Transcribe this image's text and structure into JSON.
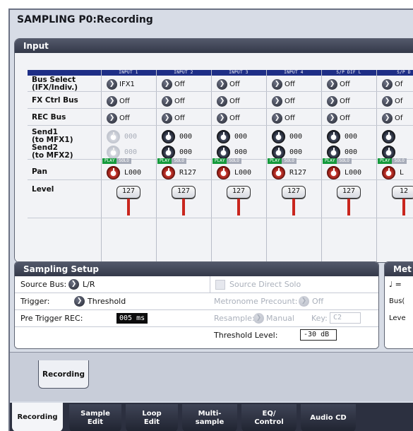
{
  "title": "SAMPLING P0:Recording",
  "input_panel": {
    "heading": "Input",
    "columns": [
      "INPUT 1",
      "INPUT 2",
      "INPUT 3",
      "INPUT 4",
      "S/P DIF L",
      "S/P D"
    ],
    "row_labels": {
      "bus_select": "Bus Select\n(IFX/Indiv.)",
      "fx_ctrl_bus": "FX Ctrl Bus",
      "rec_bus": "REC Bus",
      "send1": "Send1\n(to MFX1)",
      "send2": "Send2\n(to MFX2)",
      "pan": "Pan",
      "level": "Level"
    },
    "bus_select": [
      "IFX1",
      "Off",
      "Off",
      "Off",
      "Off",
      "Of"
    ],
    "fx_ctrl_bus": [
      "Off",
      "Off",
      "Off",
      "Off",
      "Off",
      "Of"
    ],
    "rec_bus": [
      "Off",
      "Off",
      "Off",
      "Off",
      "Off",
      "Of"
    ],
    "send1": [
      "000",
      "000",
      "000",
      "000",
      "000",
      ""
    ],
    "send2": [
      "000",
      "000",
      "000",
      "000",
      "000",
      ""
    ],
    "play_label": "PLAY",
    "solo_label": "SOLO",
    "pan": [
      "L000",
      "R127",
      "L000",
      "R127",
      "L000",
      "L"
    ],
    "level": [
      "127",
      "127",
      "127",
      "127",
      "127",
      "12"
    ]
  },
  "sampling_setup": {
    "heading": "Sampling Setup",
    "source_bus_label": "Source Bus:",
    "source_bus_value": "L/R",
    "source_direct_solo_label": "Source Direct Solo",
    "trigger_label": "Trigger:",
    "trigger_value": "Threshold",
    "metronome_precount_label": "Metronome Precount:",
    "metronome_precount_value": "Off",
    "pre_trigger_label": "Pre Trigger REC:",
    "pre_trigger_value": "005 ms",
    "resample_label": "Resample:",
    "resample_value": "Manual",
    "key_label": "Key:",
    "key_value": "C2",
    "threshold_label": "Threshold Level:",
    "threshold_value": "-30 dB"
  },
  "metronome_panel": {
    "heading": "Met",
    "line1": "♩ =",
    "line2": "Bus(",
    "line3": "Leve"
  },
  "subtab": "Recording",
  "tabs": [
    {
      "label": "Recording"
    },
    {
      "label": "Sample\nEdit"
    },
    {
      "label": "Loop\nEdit"
    },
    {
      "label": "Multi-\nsample"
    },
    {
      "label": "EQ/\nControl"
    },
    {
      "label": "Audio CD"
    }
  ],
  "colors": {
    "header_blue": "#1e2e86",
    "play_green": "#159a3c",
    "pan_red": "#c83a32",
    "fader_red": "#c9261e"
  }
}
